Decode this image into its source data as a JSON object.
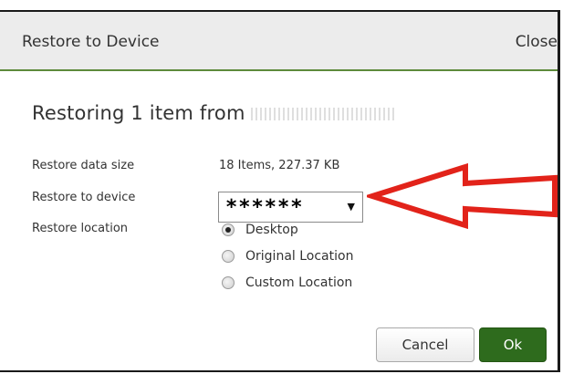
{
  "dialog": {
    "title": "Restore to Device",
    "close_label": "Close"
  },
  "heading": {
    "text": "Restoring 1 item from"
  },
  "fields": {
    "data_size_label": "Restore data size",
    "data_size_value": "18 Items, 227.37 KB",
    "device_label": "Restore to device",
    "device_value": "******",
    "location_label": "Restore location"
  },
  "location_options": [
    {
      "label": "Desktop",
      "checked": true
    },
    {
      "label": "Original Location",
      "checked": false
    },
    {
      "label": "Custom Location",
      "checked": false
    }
  ],
  "buttons": {
    "cancel_label": "Cancel",
    "ok_label": "Ok"
  },
  "colors": {
    "header_bg": "#ececec",
    "header_border": "#5d8a3c",
    "ok_button": "#2e6b1d",
    "annotation_arrow": "#e2231a"
  },
  "icons": {
    "dropdown": "caret-down-icon",
    "annotation": "red-arrow-icon"
  }
}
